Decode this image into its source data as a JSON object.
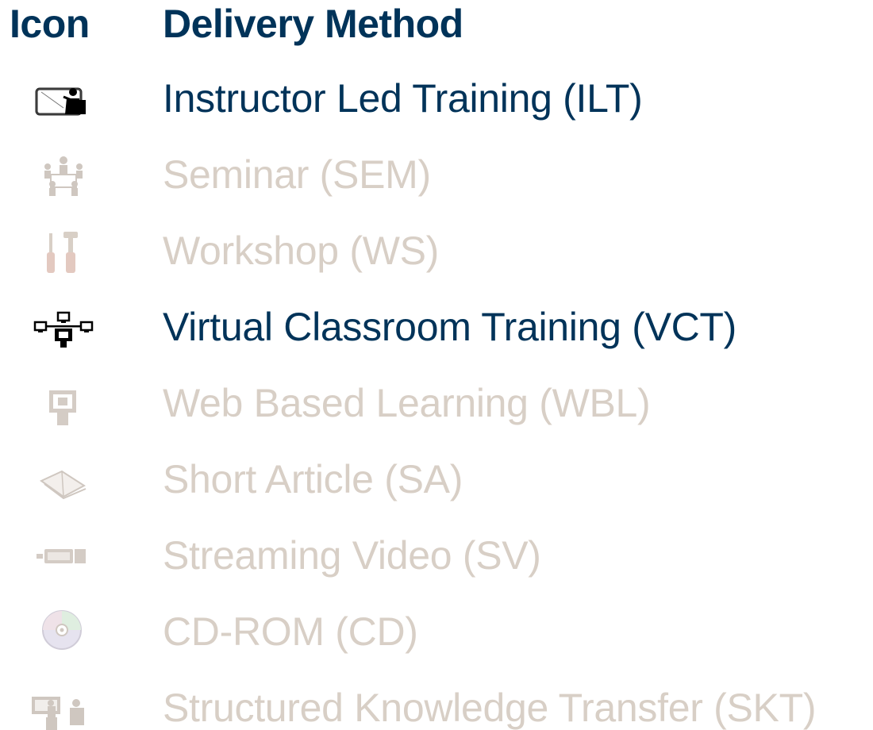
{
  "table": {
    "header": {
      "icon": "Icon",
      "method": "Delivery Method"
    },
    "rows": [
      {
        "label": "Instructor Led Training (ILT)",
        "icon": "instructor-icon",
        "active": true
      },
      {
        "label": "Seminar (SEM)",
        "icon": "seminar-icon",
        "active": false
      },
      {
        "label": "Workshop (WS)",
        "icon": "tools-icon",
        "active": false
      },
      {
        "label": "Virtual Classroom Training (VCT)",
        "icon": "network-icon",
        "active": true
      },
      {
        "label": "Web Based Learning (WBL)",
        "icon": "web-screen-icon",
        "active": false
      },
      {
        "label": "Short Article (SA)",
        "icon": "book-icon",
        "active": false
      },
      {
        "label": "Streaming Video (SV)",
        "icon": "camera-icon",
        "active": false
      },
      {
        "label": "CD-ROM (CD)",
        "icon": "cd-icon",
        "active": false
      },
      {
        "label": "Structured Knowledge Transfer (SKT)",
        "icon": "knowledge-transfer-icon",
        "active": false
      }
    ]
  },
  "colors": {
    "active_text": "#003359",
    "inactive_text": "#d8cfc6"
  }
}
